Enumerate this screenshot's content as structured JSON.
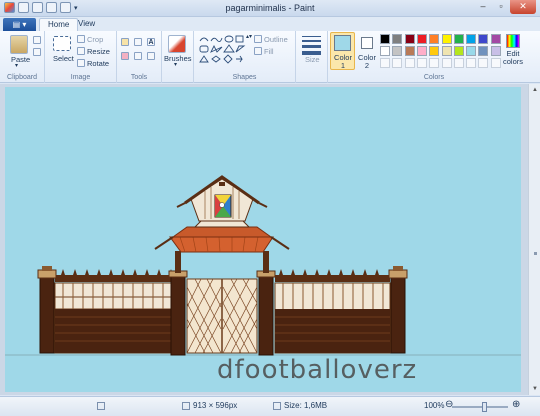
{
  "window": {
    "title": "pagarminimalis - Paint"
  },
  "tabs": [
    {
      "label": "Home"
    },
    {
      "label": "View"
    }
  ],
  "ribbon": {
    "clipboard": {
      "paste": "Paste",
      "group": "Clipboard"
    },
    "image": {
      "select": "Select",
      "crop": "Crop",
      "resize": "Resize",
      "rotate": "Rotate",
      "group": "Image"
    },
    "tools": {
      "group": "Tools"
    },
    "brushes": {
      "label": "Brushes"
    },
    "shapes": {
      "outline": "Outline",
      "fill": "Fill",
      "group": "Shapes"
    },
    "size": {
      "label": "Size"
    },
    "colors": {
      "color1": "Color 1",
      "color2": "Color 2",
      "edit": "Edit colors",
      "group": "Colors",
      "color1_value": "#9fd8e8",
      "color2_value": "#ffffff",
      "palette": [
        "#000000",
        "#7f7f7f",
        "#880015",
        "#ed1c24",
        "#ff7f27",
        "#fff200",
        "#22b14c",
        "#00a2e8",
        "#3f48cc",
        "#a349a4",
        "#ffffff",
        "#c3c3c3",
        "#b97a57",
        "#ffaec9",
        "#ffc90e",
        "#efe4b0",
        "#b5e61d",
        "#99d9ea",
        "#7092be",
        "#c8bfe7"
      ]
    }
  },
  "canvas": {
    "watermark": "dfootballoverz"
  },
  "status": {
    "dimensions": "913 × 596px",
    "size": "Size: 1,6MB",
    "zoom": "100%"
  }
}
